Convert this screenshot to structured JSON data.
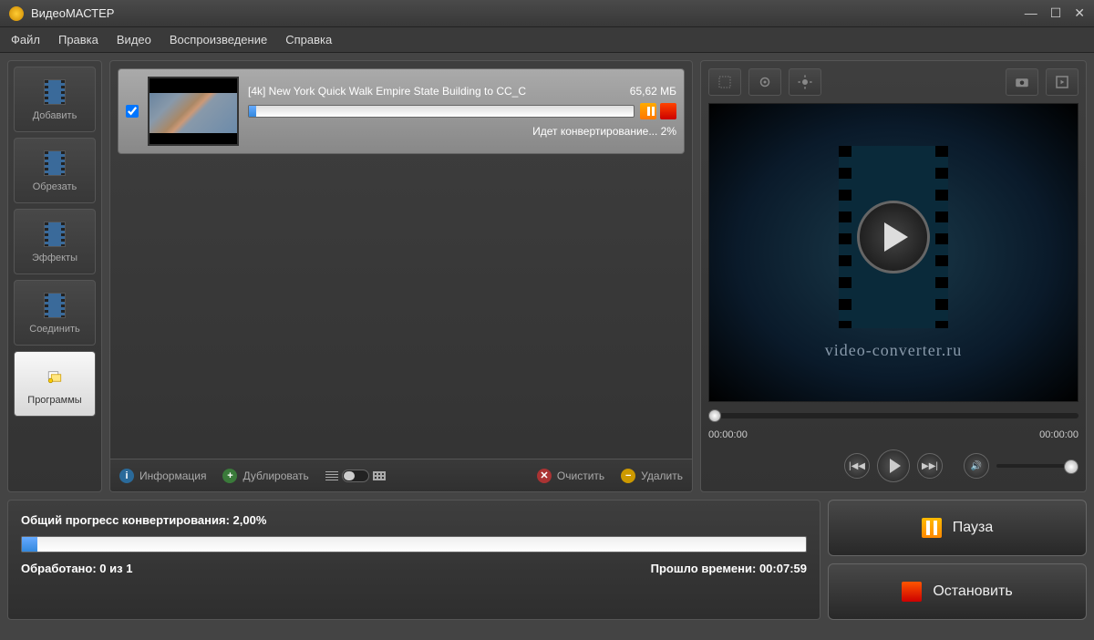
{
  "app": {
    "title": "ВидеоМАСТЕР"
  },
  "menu": {
    "file": "Файл",
    "edit": "Правка",
    "video": "Видео",
    "playback": "Воспроизведение",
    "help": "Справка"
  },
  "sidebar": {
    "add": "Добавить",
    "trim": "Обрезать",
    "effects": "Эффекты",
    "join": "Соединить",
    "programs": "Программы"
  },
  "item": {
    "title": "[4k] New York Quick Walk Empire State Building to CC_C",
    "size": "65,62 МБ",
    "status": "Идет конвертирование... 2%"
  },
  "ctoolbar": {
    "info": "Информация",
    "dup": "Дублировать",
    "clear": "Очистить",
    "delete": "Удалить"
  },
  "preview": {
    "brand": "video-converter.ru",
    "t0": "00:00:00",
    "t1": "00:00:00"
  },
  "progress": {
    "header_prefix": "Общий прогресс конвертирования: ",
    "percent": "2,00%",
    "processed_prefix": "Обработано: ",
    "processed": "0 из 1",
    "elapsed_prefix": "Прошло времени: ",
    "elapsed": "00:07:59"
  },
  "actions": {
    "pause": "Пауза",
    "stop": "Остановить"
  }
}
